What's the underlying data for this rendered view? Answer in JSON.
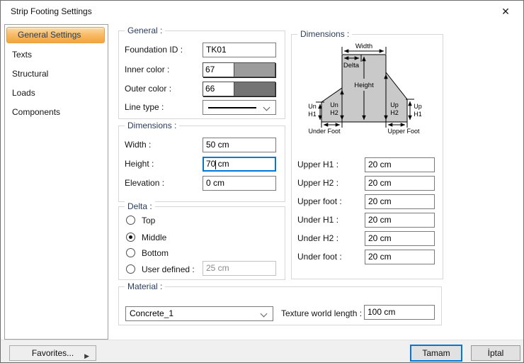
{
  "window": {
    "title": "Strip Footing Settings",
    "close_glyph": "✕"
  },
  "sidebar": {
    "items": [
      {
        "label": "General Settings",
        "selected": true
      },
      {
        "label": "Texts",
        "selected": false
      },
      {
        "label": "Structural",
        "selected": false
      },
      {
        "label": "Loads",
        "selected": false
      },
      {
        "label": "Components",
        "selected": false
      }
    ]
  },
  "general": {
    "title": "General :",
    "foundation_id_label": "Foundation ID :",
    "foundation_id_value": "TK01",
    "inner_color_label": "Inner color :",
    "inner_color_value": "67",
    "inner_color_hex": "#9c9c9c",
    "outer_color_label": "Outer color :",
    "outer_color_value": "66",
    "outer_color_hex": "#747474",
    "line_type_label": "Line type :"
  },
  "dimensions_left": {
    "title": "Dimensions :",
    "width_label": "Width :",
    "width_value": "50 cm",
    "height_label": "Height :",
    "height_value": "70 cm",
    "elevation_label": "Elevation :",
    "elevation_value": "0 cm"
  },
  "delta": {
    "title": "Delta :",
    "options": [
      {
        "label": "Top",
        "selected": false
      },
      {
        "label": "Middle",
        "selected": true
      },
      {
        "label": "Bottom",
        "selected": false
      },
      {
        "label": "User defined :",
        "selected": false
      }
    ],
    "user_defined_value": "25 cm"
  },
  "material": {
    "title": "Material :",
    "selected_value": "Concrete_1",
    "texture_label": "Texture world length :",
    "texture_value": "100 cm"
  },
  "dimensions_right": {
    "title": "Dimensions :",
    "diagram": {
      "width_label": "Width",
      "delta_label": "Delta",
      "height_label": "Height",
      "un": "Un",
      "up": "Up",
      "h1": "H1",
      "h2": "H2",
      "under_foot": "Under Foot",
      "upper_foot": "Upper Foot",
      "fill": "#c9c9c9"
    },
    "fields": [
      {
        "label": "Upper H1 :",
        "value": "20 cm"
      },
      {
        "label": "Upper H2 :",
        "value": "20 cm"
      },
      {
        "label": "Upper foot :",
        "value": "20 cm"
      },
      {
        "label": "Under H1 :",
        "value": "20 cm"
      },
      {
        "label": "Under H2 :",
        "value": "20 cm"
      },
      {
        "label": "Under foot :",
        "value": "20 cm"
      }
    ]
  },
  "footer": {
    "favorites_label": "Favorites...",
    "favorites_arrow": "▶",
    "ok_label": "Tamam",
    "cancel_label": "İptal"
  },
  "colors": {
    "accent": "#0078d7",
    "selection_border": "#dfa045",
    "selection_fill": "#f5a843"
  }
}
